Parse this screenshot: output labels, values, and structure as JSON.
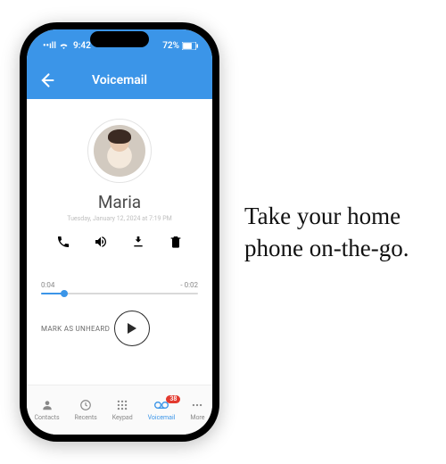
{
  "status_bar": {
    "signal": "••ıll",
    "wifi": "wifi",
    "time": "9:42",
    "battery_pct": "72%"
  },
  "header": {
    "title": "Voicemail"
  },
  "contact": {
    "name": "Maria",
    "timestamp": "Tuesday, January 12, 2024 at 7:19 PM"
  },
  "actions": {
    "call": "call-icon",
    "speaker": "speaker-icon",
    "download": "download-icon",
    "delete": "trash-icon"
  },
  "player": {
    "elapsed": "0:04",
    "remaining": "- 0:02",
    "mark_unheard": "MARK AS UNHEARD"
  },
  "tabs": {
    "items": [
      {
        "label": "Contacts"
      },
      {
        "label": "Recents"
      },
      {
        "label": "Keypad"
      },
      {
        "label": "Voicemail",
        "badge": "38"
      },
      {
        "label": "More"
      }
    ]
  },
  "tagline": "Take your home phone on-the-go."
}
